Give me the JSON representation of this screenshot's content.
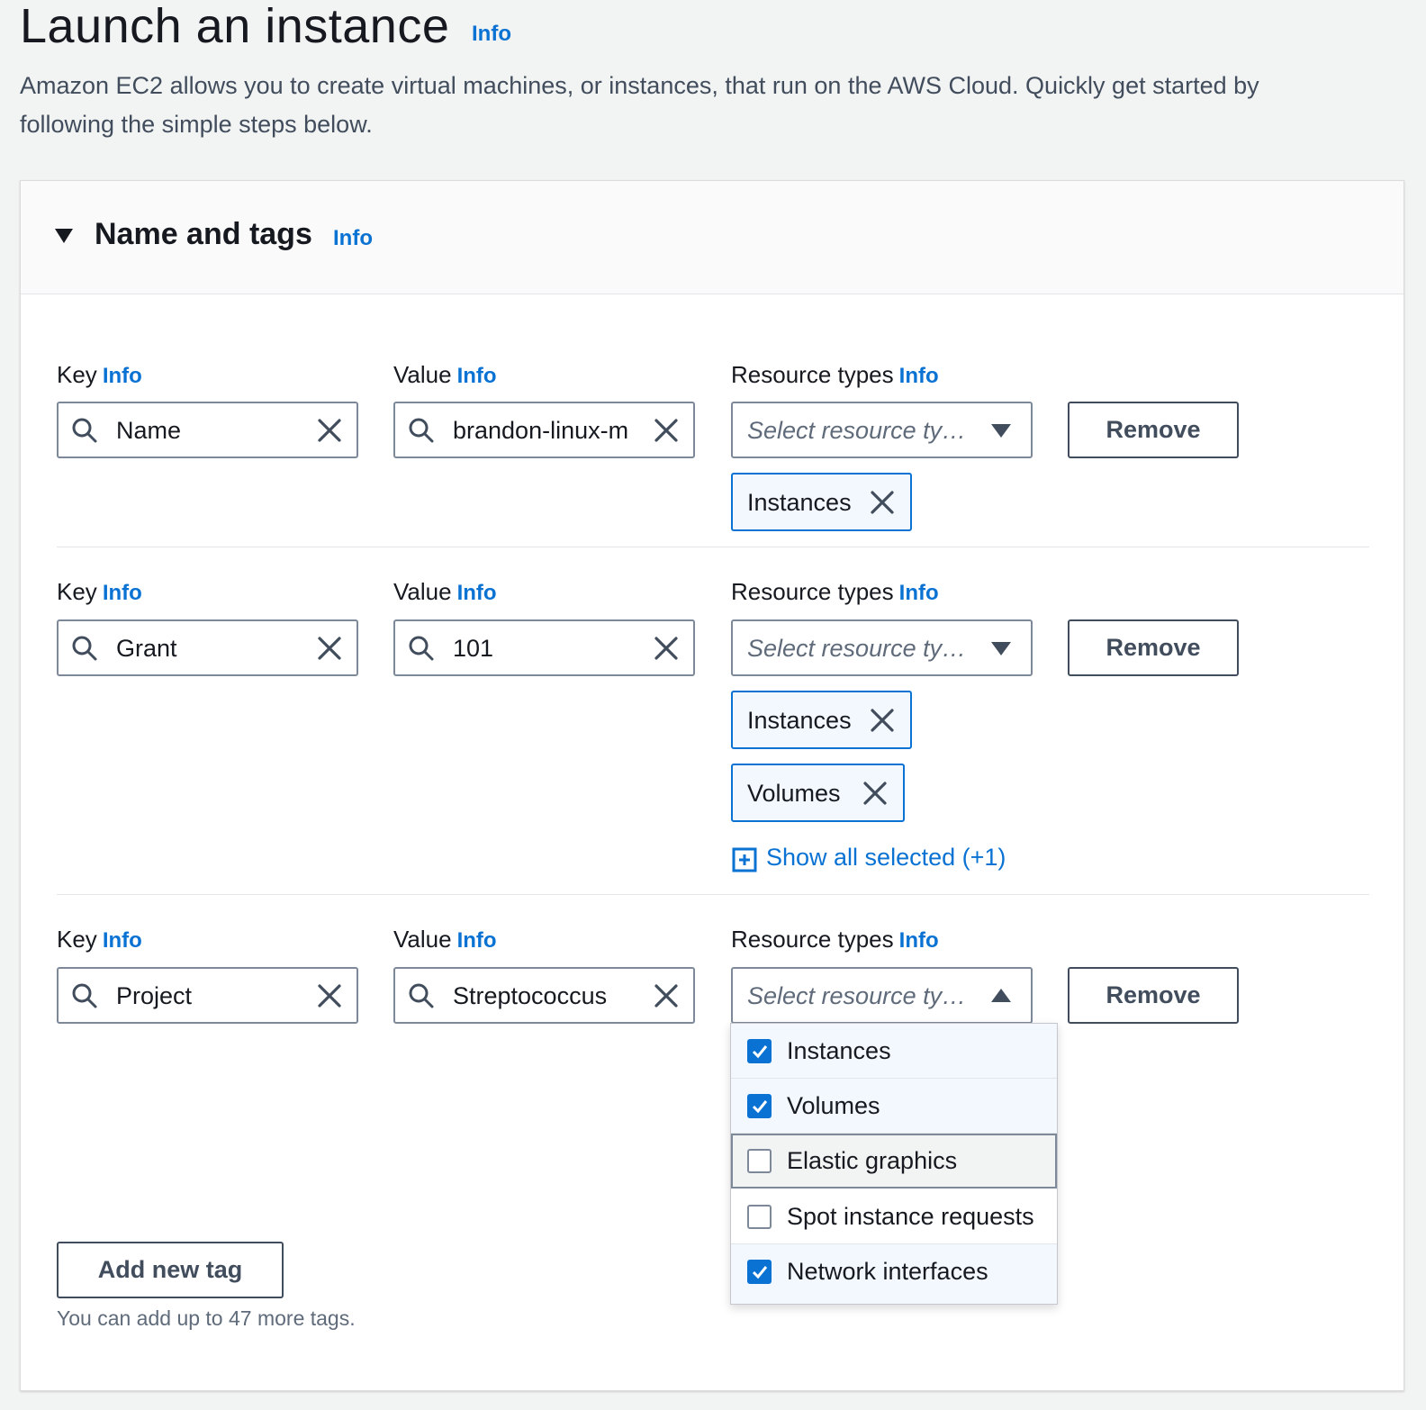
{
  "page": {
    "title": "Launch an instance",
    "info": "Info",
    "description": "Amazon EC2 allows you to create virtual machines, or instances, that run on the AWS Cloud. Quickly get started by following the simple steps below."
  },
  "section": {
    "title": "Name and tags",
    "info": "Info"
  },
  "labels": {
    "key": "Key",
    "value": "Value",
    "resource_types": "Resource types",
    "info": "Info",
    "remove": "Remove"
  },
  "tags": [
    {
      "key": "Name",
      "value": "brandon-linux-m",
      "resource_placeholder": "Select resource ty…",
      "selected": [
        "Instances"
      ]
    },
    {
      "key": "Grant",
      "value": "101",
      "resource_placeholder": "Select resource ty…",
      "selected": [
        "Instances",
        "Volumes"
      ],
      "show_all": "Show all selected (+1)"
    },
    {
      "key": "Project",
      "value": "Streptococcus",
      "resource_placeholder": "Select resource ty…",
      "dropdown_open": true
    }
  ],
  "dropdown": {
    "options": [
      {
        "label": "Instances",
        "checked": true
      },
      {
        "label": "Volumes",
        "checked": true
      },
      {
        "label": "Elastic graphics",
        "checked": false,
        "hovered": true
      },
      {
        "label": "Spot instance requests",
        "checked": false
      },
      {
        "label": "Network interfaces",
        "checked": true
      }
    ]
  },
  "footer": {
    "add_tag": "Add new tag",
    "limit_text": "You can add up to 47 more tags."
  },
  "colors": {
    "accent": "#0972d3",
    "background": "#f2f3f3",
    "text": "#16191f",
    "token_bg": "#f2f8fd"
  },
  "icons": [
    "search-icon",
    "clear-icon",
    "caret-down-icon",
    "caret-up-icon",
    "dismiss-icon",
    "expand-icon",
    "check-icon"
  ]
}
